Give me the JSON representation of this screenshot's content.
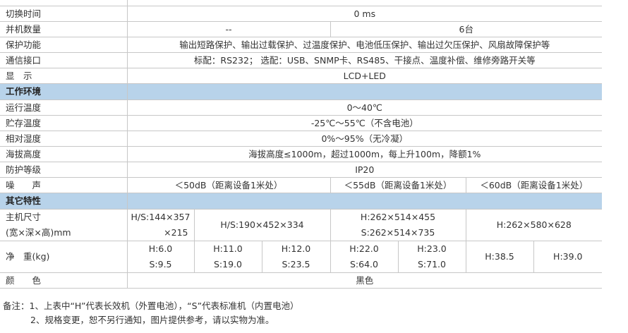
{
  "rows": {
    "switch_time": {
      "label": "切换时间",
      "value": "0 ms"
    },
    "parallel": {
      "label": "并机数量",
      "value_a": "--",
      "value_b": "6台"
    },
    "protection": {
      "label": "保护功能",
      "value": "输出短路保护、输出过载保护、过温度保护、电池低压保护、输出过欠压保护、风扇故障保护等"
    },
    "interface": {
      "label": "通信接口",
      "value": "标配：RS232；  选配：USB、SNMP卡、RS485、干接点、温度补偿、维修旁路开关等"
    },
    "display": {
      "label": "显　示",
      "value": "LCD+LED"
    }
  },
  "section_env": "工作环境",
  "env": {
    "op_temp": {
      "label": "运行温度",
      "value": "0～40℃"
    },
    "storage_temp": {
      "label": "贮存温度",
      "value": "-25℃～55℃（不含电池）"
    },
    "humidity": {
      "label": "相对湿度",
      "value": "0%～95%（无冷凝）"
    },
    "altitude": {
      "label": "海拔高度",
      "value": "海拔高度≤1000m，超过1000m，每上升100m，降额1%"
    },
    "ip": {
      "label": "防护等级",
      "value": "IP20"
    },
    "noise": {
      "label": "噪　　声",
      "value_a": "＜50dB（距离设备1米处）",
      "value_b": "＜55dB（距离设备1米处）",
      "value_c": "＜60dB（距离设备1米处）"
    }
  },
  "section_other": "其它特性",
  "other": {
    "size": {
      "label_line1": "主机尺寸",
      "label_line2": "(宽×深×高)mm",
      "v1_line1": "H/S:144×357",
      "v1_line2": "×215",
      "v2": "H/S:190×452×334",
      "v3_line1": "H:262×514×455",
      "v3_line2": "S:262×514×735",
      "v4": "H:262×580×628"
    },
    "weight": {
      "label": "净　重(kg)",
      "w1a": "H:6.0",
      "w1b": "S:9.5",
      "w2a": "H:11.0",
      "w2b": "S:19.0",
      "w3a": "H:12.0",
      "w3b": "S:23.5",
      "w4a": "H:22.0",
      "w4b": "S:64.0",
      "w5a": "H:23.0",
      "w5b": "S:71.0",
      "w6": "H:38.5",
      "w7": "H:39.0"
    },
    "color": {
      "label": "颜　　色",
      "value": "黑色"
    }
  },
  "notes": {
    "line1": "备注：1、上表中“H”代表长效机（外置电池），“S”代表标准机（内置电池）",
    "line2": "2、规格变更，恕不另行通知，图片提供参考，请以实物为准。"
  }
}
